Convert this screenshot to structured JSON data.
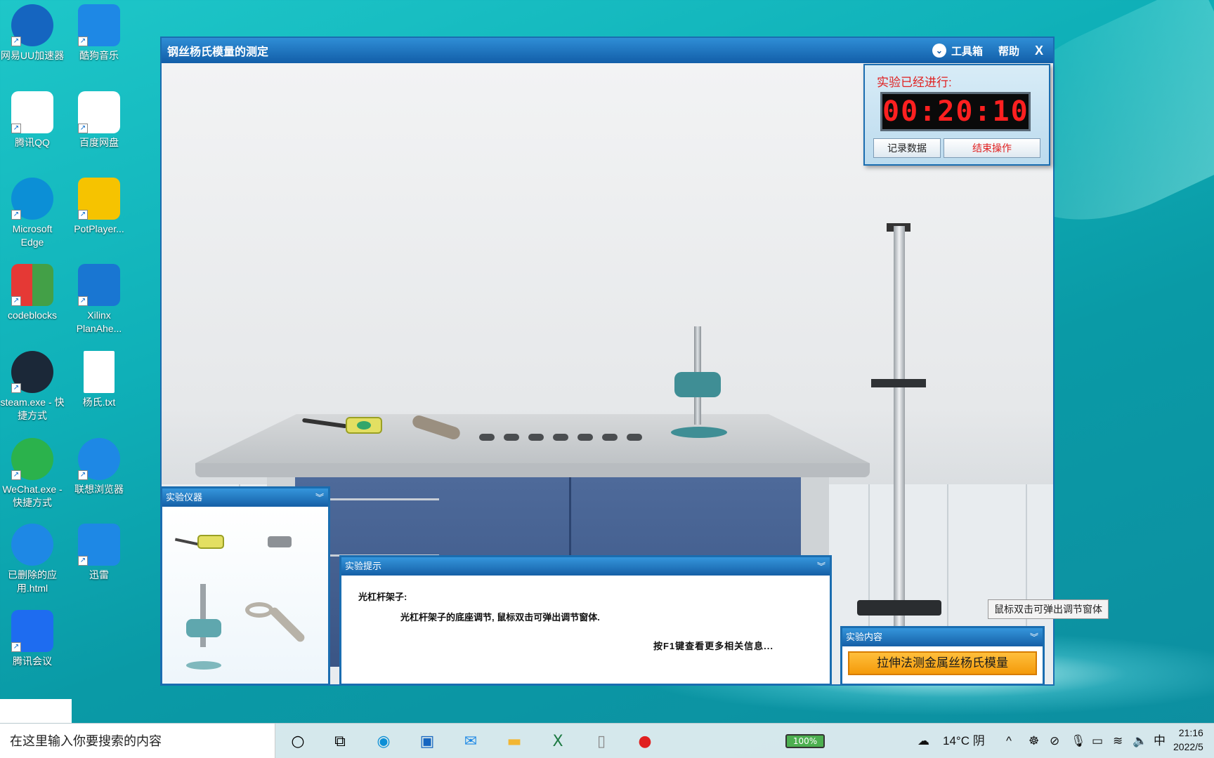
{
  "desktop": {
    "icons": [
      {
        "label": "网易UU加速器",
        "icon": "uu-accelerator-icon",
        "color": "#1565c0"
      },
      {
        "label": "酷狗音乐",
        "icon": "kugou-music-icon",
        "color": "#1e88e5"
      },
      {
        "label": "腾讯QQ",
        "icon": "qq-icon",
        "color": "#ffffff"
      },
      {
        "label": "百度网盘",
        "icon": "baidu-netdisk-icon",
        "color": "#ffffff"
      },
      {
        "label": "Microsoft Edge",
        "icon": "edge-icon",
        "color": "#0c8fd6"
      },
      {
        "label": "PotPlayer...",
        "icon": "potplayer-icon",
        "color": "#f6c300"
      },
      {
        "label": "codeblocks",
        "icon": "codeblocks-icon",
        "color": "#e53935"
      },
      {
        "label": "Xilinx PlanAhe...",
        "icon": "xilinx-icon",
        "color": "#1976d2"
      },
      {
        "label": "steam.exe - 快捷方式",
        "icon": "steam-icon",
        "color": "#1b2838"
      },
      {
        "label": "杨氏.txt",
        "icon": "text-file-icon",
        "color": "#ffffff"
      },
      {
        "label": "WeChat.exe - 快捷方式",
        "icon": "wechat-icon",
        "color": "#2bb24c"
      },
      {
        "label": "联想浏览器",
        "icon": "lenovo-browser-icon",
        "color": "#1e88e5"
      },
      {
        "label": "已删除的应用.html",
        "icon": "deleted-app-icon",
        "color": "#1e88e5"
      },
      {
        "label": "迅雷",
        "icon": "thunder-icon",
        "color": "#1e88e5"
      },
      {
        "label": "腾讯会议",
        "icon": "tencent-meeting-icon",
        "color": "#1e6cf0"
      }
    ]
  },
  "window": {
    "title": "钢丝杨氏模量的测定",
    "toolbox": "工具箱",
    "help": "帮助",
    "close": "X"
  },
  "timer": {
    "label": "实验已经进行:",
    "value": "00:20:10",
    "record_button": "记录数据",
    "end_button": "结束操作"
  },
  "instruments": {
    "title": "实验仪器"
  },
  "hints": {
    "title": "实验提示",
    "line1": "光杠杆架子:",
    "line2": "光杠杆架子的底座调节, 鼠标双击可弹出调节窗体.",
    "line3": "按F1键查看更多相关信息..."
  },
  "content": {
    "title": "实验内容",
    "button": "拉伸法测金属丝杨氏模量"
  },
  "tooltip": "鼠标双击可弹出调节窗体",
  "taskbar": {
    "search_placeholder": "在这里输入你要搜索的内容",
    "battery": "100%",
    "weather": "14°C  阴",
    "ime": "中",
    "time": "21:16",
    "date": "2022/5"
  }
}
